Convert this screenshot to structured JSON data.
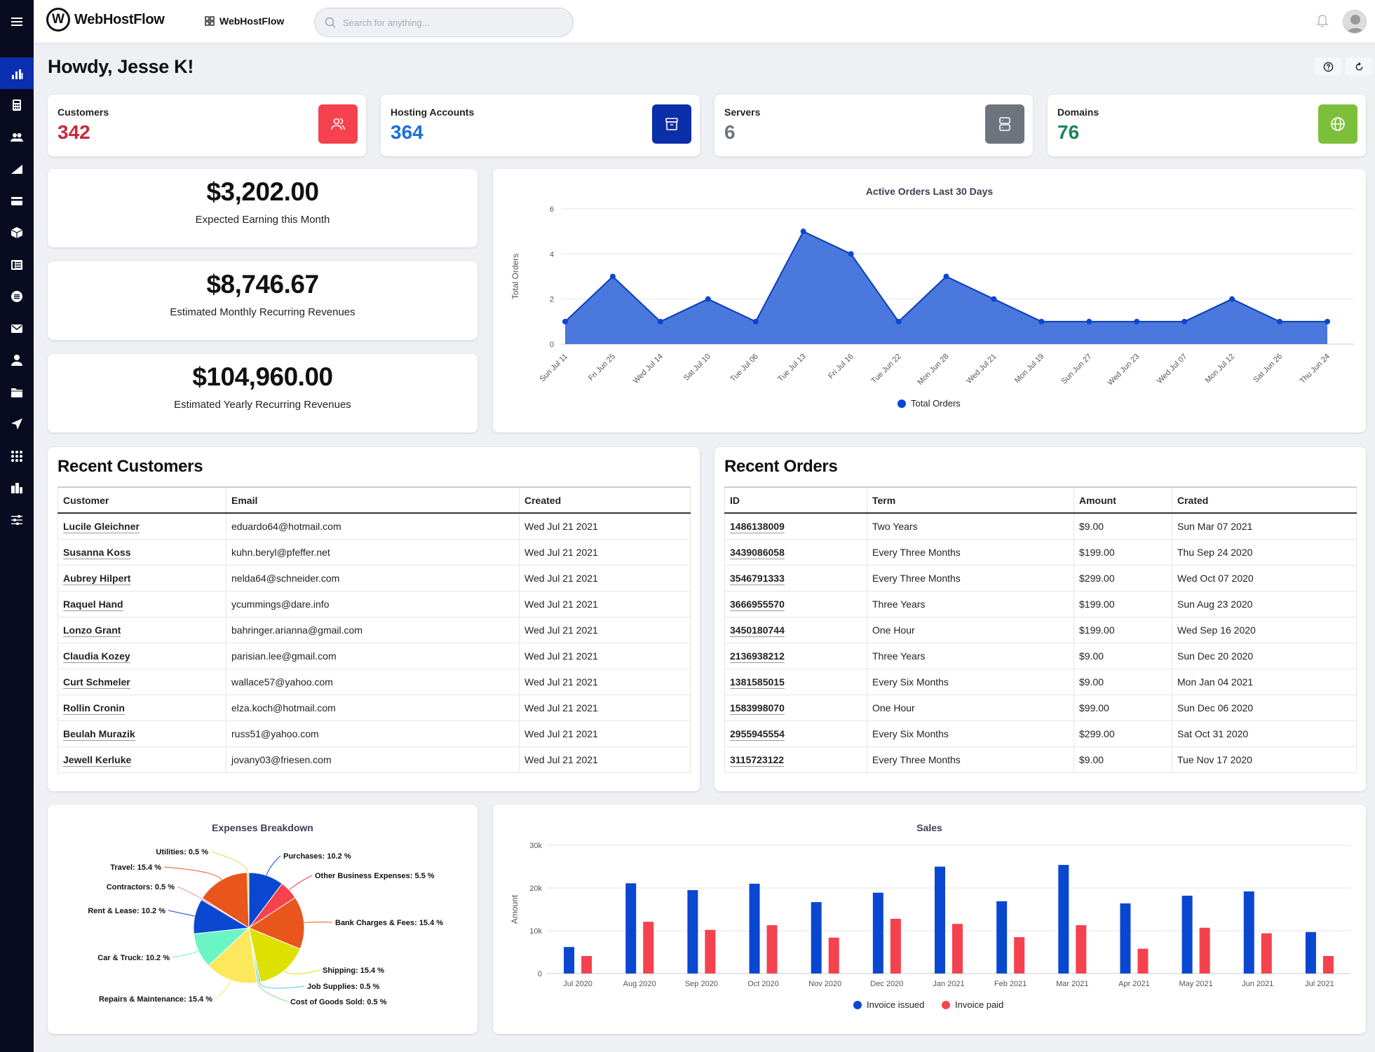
{
  "app": {
    "brand": "WebHostFlow",
    "workspace_label": "WebHostFlow",
    "search_placeholder": "Search for anything...",
    "greeting": "Howdy, Jesse K!"
  },
  "sidebar": {
    "items": [
      {
        "icon": "bar-chart-icon",
        "label": "Dashboard",
        "active": true
      },
      {
        "icon": "calculator-icon",
        "label": "Billing"
      },
      {
        "icon": "users-icon",
        "label": "Customers"
      },
      {
        "icon": "signal-icon",
        "label": "Reports"
      },
      {
        "icon": "credit-card-icon",
        "label": "Payments"
      },
      {
        "icon": "box-icon",
        "label": "Products"
      },
      {
        "icon": "list-icon",
        "label": "Orders"
      },
      {
        "icon": "chat-list-icon",
        "label": "Tickets"
      },
      {
        "icon": "envelope-icon",
        "label": "Mail"
      },
      {
        "icon": "user-icon",
        "label": "Account"
      },
      {
        "icon": "folder-icon",
        "label": "Files"
      },
      {
        "icon": "send-icon",
        "label": "Send"
      },
      {
        "icon": "grid-icon",
        "label": "Apps"
      },
      {
        "icon": "buildings-icon",
        "label": "Company"
      },
      {
        "icon": "sliders-icon",
        "label": "Settings"
      }
    ]
  },
  "stats": [
    {
      "label": "Customers",
      "value": "342",
      "color": "#c8283c",
      "icon_bg": "#f5424e",
      "icon": "users-icon"
    },
    {
      "label": "Hosting Accounts",
      "value": "364",
      "color": "#1a6fdc",
      "icon_bg": "#0a2fa8",
      "icon": "archive-icon"
    },
    {
      "label": "Servers",
      "value": "6",
      "color": "#6c757d",
      "icon_bg": "#6c757d",
      "icon": "server-icon"
    },
    {
      "label": "Domains",
      "value": "76",
      "color": "#198754",
      "icon_bg": "#7cbf3a",
      "icon": "globe-icon"
    }
  ],
  "earnings": [
    {
      "value": "$3,202.00",
      "label": "Expected Earning this Month"
    },
    {
      "value": "$8,746.67",
      "label": "Estimated Monthly Recurring Revenues"
    },
    {
      "value": "$104,960.00",
      "label": "Estimated Yearly Recurring Revenues"
    }
  ],
  "recent_customers": {
    "title": "Recent Customers",
    "columns": [
      "Customer",
      "Email",
      "Created"
    ],
    "rows": [
      [
        "Lucile Gleichner",
        "eduardo64@hotmail.com",
        "Wed Jul 21 2021"
      ],
      [
        "Susanna Koss",
        "kuhn.beryl@pfeffer.net",
        "Wed Jul 21 2021"
      ],
      [
        "Aubrey Hilpert",
        "nelda64@schneider.com",
        "Wed Jul 21 2021"
      ],
      [
        "Raquel Hand",
        "ycummings@dare.info",
        "Wed Jul 21 2021"
      ],
      [
        "Lonzo Grant",
        "bahringer.arianna@gmail.com",
        "Wed Jul 21 2021"
      ],
      [
        "Claudia Kozey",
        "parisian.lee@gmail.com",
        "Wed Jul 21 2021"
      ],
      [
        "Curt Schmeler",
        "wallace57@yahoo.com",
        "Wed Jul 21 2021"
      ],
      [
        "Rollin Cronin",
        "elza.koch@hotmail.com",
        "Wed Jul 21 2021"
      ],
      [
        "Beulah Murazik",
        "russ51@yahoo.com",
        "Wed Jul 21 2021"
      ],
      [
        "Jewell Kerluke",
        "jovany03@friesen.com",
        "Wed Jul 21 2021"
      ]
    ]
  },
  "recent_orders": {
    "title": "Recent Orders",
    "columns": [
      "ID",
      "Term",
      "Amount",
      "Crated"
    ],
    "rows": [
      [
        "1486138009",
        "Two Years",
        "$9.00",
        "Sun Mar 07 2021"
      ],
      [
        "3439086058",
        "Every Three Months",
        "$199.00",
        "Thu Sep 24 2020"
      ],
      [
        "3546791333",
        "Every Three Months",
        "$299.00",
        "Wed Oct 07 2020"
      ],
      [
        "3666955570",
        "Three Years",
        "$199.00",
        "Sun Aug 23 2020"
      ],
      [
        "3450180744",
        "One Hour",
        "$199.00",
        "Wed Sep 16 2020"
      ],
      [
        "2136938212",
        "Three Years",
        "$9.00",
        "Sun Dec 20 2020"
      ],
      [
        "1381585015",
        "Every Six Months",
        "$9.00",
        "Mon Jan 04 2021"
      ],
      [
        "1583998070",
        "One Hour",
        "$99.00",
        "Sun Dec 06 2020"
      ],
      [
        "2955945554",
        "Every Six Months",
        "$299.00",
        "Sat Oct 31 2020"
      ],
      [
        "3115723122",
        "Every Three Months",
        "$9.00",
        "Tue Nov 17 2020"
      ]
    ]
  },
  "chart_data": [
    {
      "type": "area",
      "title": "Active Orders Last 30 Days",
      "xlabel": "",
      "ylabel": "Total Orders",
      "ylim": [
        0,
        6
      ],
      "yticks": [
        0,
        2,
        4,
        6
      ],
      "grid": true,
      "legend": "bottom",
      "categories": [
        "Sun Jul 11",
        "Fri Jun 25",
        "Wed Jul 14",
        "Sat Jul 10",
        "Tue Jul 06",
        "Tue Jul 13",
        "Fri Jul 16",
        "Tue Jun 22",
        "Mon Jun 28",
        "Wed Jul 21",
        "Mon Jul 19",
        "Sun Jun 27",
        "Wed Jun 23",
        "Wed Jul 07",
        "Mon Jul 12",
        "Sat Jun 26",
        "Thu Jun 24"
      ],
      "series": [
        {
          "name": "Total Orders",
          "color": "#0a47d1",
          "values": [
            1,
            3,
            1,
            2,
            1,
            5,
            4,
            1,
            3,
            2,
            1,
            1,
            1,
            1,
            2,
            1,
            1
          ]
        }
      ]
    },
    {
      "type": "pie",
      "title": "Expenses Breakdown",
      "legend": "none",
      "slices": [
        {
          "label": "Purchases",
          "value": 10.2,
          "color": "#0a47d1"
        },
        {
          "label": "Other Business Expenses",
          "value": 5.5,
          "color": "#f5424e"
        },
        {
          "label": "Bank Charges & Fees",
          "value": 15.4,
          "color": "#e9561c"
        },
        {
          "label": "Shipping",
          "value": 15.4,
          "color": "#dde000"
        },
        {
          "label": "Job Supplies",
          "value": 0.5,
          "color": "#4fc3e8"
        },
        {
          "label": "Cost of Goods Sold",
          "value": 0.5,
          "color": "#7ee07a"
        },
        {
          "label": "Repairs & Maintenance",
          "value": 15.4,
          "color": "#fde85d"
        },
        {
          "label": "Car & Truck",
          "value": 10.2,
          "color": "#6af5c5"
        },
        {
          "label": "Rent & Lease",
          "value": 10.2,
          "color": "#0a47d1"
        },
        {
          "label": "Contractors",
          "value": 0.5,
          "color": "#f58aa0"
        },
        {
          "label": "Travel",
          "value": 15.4,
          "color": "#e9561c"
        },
        {
          "label": "Utilities",
          "value": 0.5,
          "color": "#e6d84a"
        }
      ]
    },
    {
      "type": "bar",
      "title": "Sales",
      "xlabel": "",
      "ylabel": "Amount",
      "ylim": [
        0,
        30000
      ],
      "yticks": [
        0,
        10000,
        20000,
        30000
      ],
      "ytick_labels": [
        "0",
        "10k",
        "20k",
        "30k"
      ],
      "grid": true,
      "legend": "bottom",
      "categories": [
        "Jul 2020",
        "Aug 2020",
        "Sep 2020",
        "Oct 2020",
        "Nov 2020",
        "Dec 2020",
        "Jan 2021",
        "Feb 2021",
        "Mar 2021",
        "Apr 2021",
        "May 2021",
        "Jun 2021",
        "Jul 2021"
      ],
      "series": [
        {
          "name": "Invoice issued",
          "color": "#0a47d1",
          "values": [
            6200,
            21100,
            19500,
            21000,
            16700,
            18900,
            25000,
            16900,
            25400,
            16400,
            18200,
            19200,
            9700
          ]
        },
        {
          "name": "Invoice paid",
          "color": "#f5424e",
          "values": [
            4100,
            12100,
            10200,
            11300,
            8400,
            12800,
            11600,
            8500,
            11300,
            5800,
            10700,
            9400,
            4100
          ]
        }
      ]
    }
  ]
}
